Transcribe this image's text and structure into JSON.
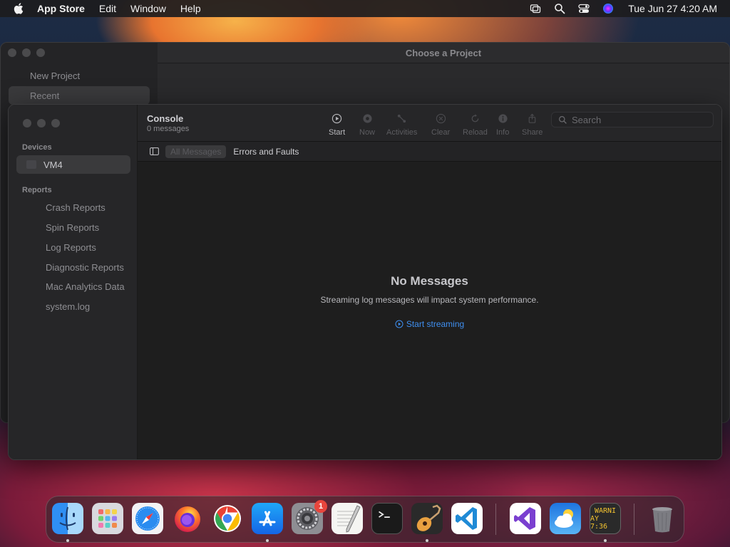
{
  "menubar": {
    "app_name": "App Store",
    "items": [
      "Edit",
      "Window",
      "Help"
    ],
    "clock": "Tue Jun 27  4:20 AM"
  },
  "back_window": {
    "title": "Choose a Project",
    "items": [
      "New Project",
      "Recent"
    ]
  },
  "console": {
    "title": "Console",
    "subtitle": "0 messages",
    "sidebar": {
      "devices_header": "Devices",
      "device": "VM4",
      "reports_header": "Reports",
      "reports": [
        "Crash Reports",
        "Spin Reports",
        "Log Reports",
        "Diagnostic Reports",
        "Mac Analytics Data",
        "system.log"
      ]
    },
    "toolbar": {
      "start": "Start",
      "now": "Now",
      "activities": "Activities",
      "clear": "Clear",
      "reload": "Reload",
      "info": "Info",
      "share": "Share"
    },
    "search": {
      "placeholder": "Search"
    },
    "filters": {
      "all": "All Messages",
      "errors": "Errors and Faults"
    },
    "empty_state": {
      "title": "No Messages",
      "description": "Streaming log messages will impact system performance.",
      "action": "Start streaming"
    }
  },
  "dock": {
    "apps": [
      "Finder",
      "Launchpad",
      "Safari",
      "Firefox",
      "Chrome",
      "App Store",
      "System Settings",
      "TextEdit",
      "Terminal",
      "GarageBand",
      "Visual Studio Code",
      "Visual Studio",
      "Weather",
      "Console",
      "Trash"
    ],
    "settings_badge": "1",
    "console_icon_text": [
      "WARNI",
      "AY 7:36"
    ]
  }
}
